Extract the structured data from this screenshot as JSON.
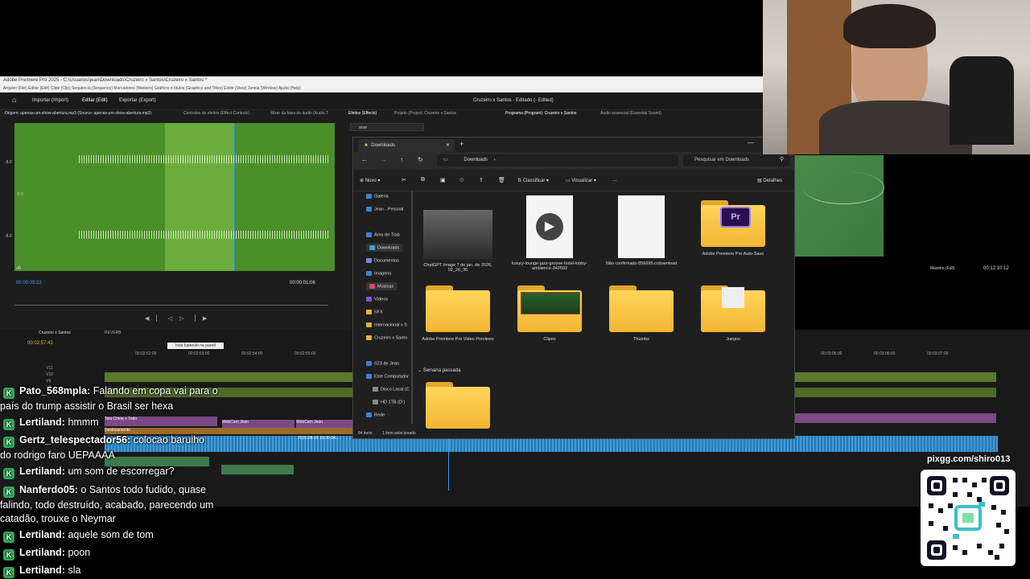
{
  "premiere": {
    "window_title": "Adobe Premiere Pro 2025 - C:\\Usuarios\\jean\\Downloads\\Cruzeiro x Santos\\Cruzeiro x Santos *",
    "menu": "Arquivo (File)   Editar (Edit)   Clipe (Clip)   Sequência (Sequence)   Marcadores (Markers)   Gráficos e títulos (Graphics and Titles)   Exibir (View)   Janela (Window)   Ajuda (Help)",
    "nav": {
      "import": "Importar (Import)",
      "edit": "Editar (Edit)",
      "export": "Exportar (Export)",
      "project_status": "Cruzeiro x Santos - Editado (- Edited)"
    },
    "panel_tabs": {
      "source": "Origem: apenas-um-show-abertura.mp3 (Source: apenas-um-show-abertura.mp3)",
      "effect_controls": "Controles de efeitos (Effect Controls)",
      "audio_mixer": "Mixer da faixa de áudio (Audio T",
      "effects": "Efeitos (Effects)",
      "project": "Projeto (Project: Cruzeiro x Santos",
      "program": "Programa (Program): Cruzeiro x Santos",
      "essential_sound": "Áudio essencial (Essential Sound)"
    },
    "effects_search": "reve",
    "db_labels": [
      "-5.0",
      "-0.0",
      "-5.0",
      "dB"
    ],
    "source_timecode": "00:00:03:22",
    "source_duration": "00:00:01:06",
    "program_zoom": "Máximo (Full)",
    "program_timecode": "00:12:10:12",
    "sequence_name": "Cruzeiro x Santos",
    "reverb_tab": "REVERB",
    "timeline_timecode": "00:02:57:43",
    "marker_label": "bola batendo na pared",
    "ruler": [
      "00:02:52:00",
      "00:02:53:00",
      "00:02:54:00",
      "00:02:55:00"
    ],
    "ruler_right": [
      "00:03:05:00",
      "00:03:06:00",
      "00:03:07:00"
    ],
    "tracks": [
      "V11",
      "V10",
      "V9",
      "V8"
    ],
    "clips": [
      "Tela Cheia + Todo",
      "WebCam Jean",
      "WebCam Jean",
      "Deslocamento",
      "2025-08-10 19-39-34..."
    ]
  },
  "explorer": {
    "tab_title": "Downloads",
    "breadcrumb": "Downloads",
    "search_placeholder": "Pesquisar em Downloads",
    "cmd": {
      "new": "Novo",
      "sort": "Classificar",
      "view": "Visualizar",
      "more": "...",
      "details": "Detalhes"
    },
    "sidebar": [
      {
        "label": "Galeria",
        "color": "#3b82d6"
      },
      {
        "label": "Jean - Pessoal",
        "color": "#3b82d6"
      },
      {
        "label": "Área de Trab",
        "color": "#3b82d6"
      },
      {
        "label": "Downloads",
        "color": "#3aa0d6"
      },
      {
        "label": "Documentos",
        "color": "#6b8fd6"
      },
      {
        "label": "Imagens",
        "color": "#3b82d6"
      },
      {
        "label": "Músicas",
        "color": "#d64a6b"
      },
      {
        "label": "Vídeos",
        "color": "#7b5ad6"
      },
      {
        "label": "SFX",
        "color": "#e5b33a"
      },
      {
        "label": "Internacional x S",
        "color": "#e5b33a"
      },
      {
        "label": "Cruzeiro x Santo",
        "color": "#e5b33a"
      },
      {
        "label": "S23 de Jean",
        "color": "#3b82d6"
      },
      {
        "label": "Este Computador",
        "color": "#3b82d6"
      },
      {
        "label": "Disco Local (C",
        "color": "#8a8a8a"
      },
      {
        "label": "HD 1TB (D:)",
        "color": "#8a8a8a"
      },
      {
        "label": "Rede",
        "color": "#3b82d6"
      }
    ],
    "files_row1": [
      {
        "name": "ChatGPT Image 7 de jan. de 2026, 02_26_36",
        "kind": "image"
      },
      {
        "name": "luxury-lounge-jazz-groove-hotel-lobby-ambience-342592",
        "kind": "audio"
      },
      {
        "name": "Não confirmado 856695.crdownload",
        "kind": "blank"
      },
      {
        "name": "Adobe Premiere Pro Auto-Save",
        "kind": "pr-folder"
      }
    ],
    "files_row2": [
      {
        "name": "Adobe Premiere Pro Video Previews",
        "kind": "folder"
      },
      {
        "name": "Clipes",
        "kind": "thumb-folder"
      },
      {
        "name": "Thumbs",
        "kind": "folder"
      },
      {
        "name": "Juegos",
        "kind": "doc-folder"
      }
    ],
    "group_header": "Semana passada",
    "status": {
      "count": "84 itens",
      "selected": "1 item selecionado"
    }
  },
  "chat": [
    {
      "user": "Pato_568mpla:",
      "text": "Falando em copa vai para o",
      "cont": "país do trump assistir o Brasil ser hexa"
    },
    {
      "user": "Lertiland:",
      "text": "hmmm"
    },
    {
      "user": "Gertz_telespectador56:",
      "text": "colocao baruiho",
      "cont": "do rodrigo faro UEPAAAA"
    },
    {
      "user": "Lertiland:",
      "text": "um som de escorregar?"
    },
    {
      "user": "Nanferdo05:",
      "text": "o Santos todo fudido, quase",
      "cont": "falindo, todo destruído, acabado, parecendo um",
      "cont2": "catadão, trouxe o Neymar"
    },
    {
      "user": "Lertiland:",
      "text": "aquele som de tom"
    },
    {
      "user": "Lertiland:",
      "text": "poon"
    },
    {
      "user": "Lertiland:",
      "text": "sla"
    }
  ],
  "overlay": {
    "qr_url": "pixgg.com/shiro013"
  }
}
